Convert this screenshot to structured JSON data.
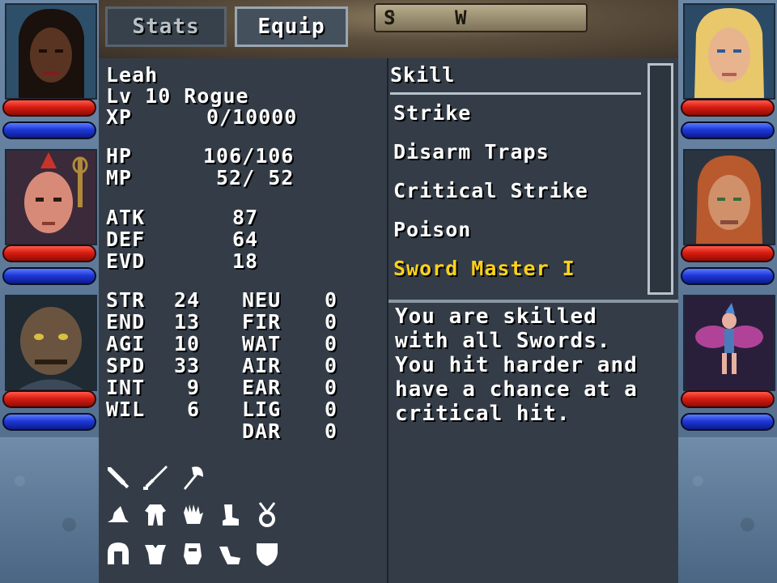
{
  "tabs": {
    "stats": "Stats",
    "equip": "Equip"
  },
  "compass": {
    "south": "S",
    "west": "W"
  },
  "character": {
    "name": "Leah",
    "level_class": "Lv 10 Rogue",
    "xp_label": "XP",
    "xp_value": "0/10000",
    "hp_label": "HP",
    "hp_value": "106/106",
    "mp_label": "MP",
    "mp_value": "52/ 52",
    "atk_label": "ATK",
    "atk_value": "87",
    "def_label": "DEF",
    "def_value": "64",
    "evd_label": "EVD",
    "evd_value": "18"
  },
  "attributes": [
    {
      "label": "STR",
      "value": "24"
    },
    {
      "label": "END",
      "value": "13"
    },
    {
      "label": "AGI",
      "value": "10"
    },
    {
      "label": "SPD",
      "value": "33"
    },
    {
      "label": "INT",
      "value": "9"
    },
    {
      "label": "WIL",
      "value": "6"
    }
  ],
  "resistances": [
    {
      "label": "NEU",
      "value": "0"
    },
    {
      "label": "FIR",
      "value": "0"
    },
    {
      "label": "WAT",
      "value": "0"
    },
    {
      "label": "AIR",
      "value": "0"
    },
    {
      "label": "EAR",
      "value": "0"
    },
    {
      "label": "LIG",
      "value": "0"
    },
    {
      "label": "DAR",
      "value": "0"
    }
  ],
  "equipment_icons": [
    [
      "dagger-icon",
      "sword-icon",
      "axe-icon"
    ],
    [
      "hat-icon",
      "robe-icon",
      "glove-icon",
      "boot-icon",
      "amulet-icon"
    ],
    [
      "helmet-icon",
      "armor-icon",
      "gauntlet-icon",
      "greaves-icon",
      "shield-icon"
    ]
  ],
  "skills": {
    "header": "Skill",
    "items": [
      "Strike",
      "Disarm Traps",
      "Critical Strike",
      "Poison",
      "Sword Master I"
    ],
    "selected_index": 4
  },
  "description": [
    "You are skilled",
    "with all Swords.",
    "You hit harder and",
    "have a chance at a",
    "critical hit."
  ],
  "colors": {
    "panel": "#343d47",
    "selected_skill": "#ffd21a",
    "hp_bar": "#d81d12",
    "mp_bar": "#1e38d8"
  }
}
